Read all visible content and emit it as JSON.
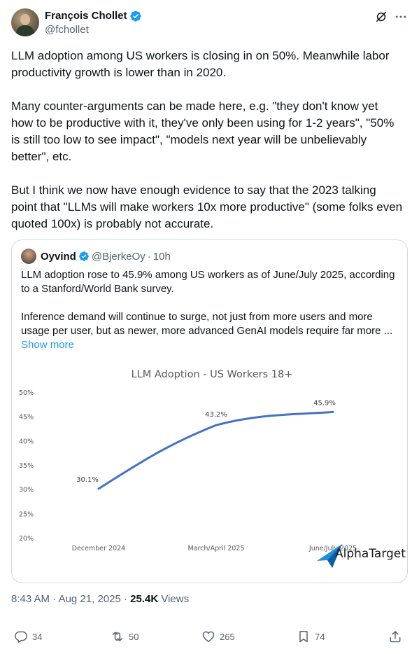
{
  "author": {
    "display_name": "François Chollet",
    "handle": "@fchollet"
  },
  "tweet": {
    "text": "LLM adoption among US workers is closing in on 50%. Meanwhile labor productivity growth is lower than in 2020.\n\nMany counter-arguments can be made here, e.g. \"they don't know yet how to be productive with it, they've only been using for 1-2 years\", \"50% is still too low to see impact\", \"models next year will be unbelievably better\", etc.\n\nBut I think we now have enough evidence to say that the 2023 talking point that \"LLMs will make workers 10x more productive\" (some folks even quoted 100x) is probably not accurate."
  },
  "quoted": {
    "display_name": "Oyvind",
    "handle": "@BjerkeOy",
    "separator": "·",
    "time": "10h",
    "text": "LLM adoption rose to 45.9% among US workers as of June/July 2025, according to a Stanford/World Bank survey.\n\nInference demand will continue to surge, not just from more users and more usage per user, but as newer, more advanced GenAI models require far more ...",
    "show_more": "Show more"
  },
  "chart_data": {
    "type": "line",
    "title": "LLM Adoption - US Workers 18+",
    "categories": [
      "December 2024",
      "March/April 2025",
      "June/July 2025"
    ],
    "values": [
      30.1,
      43.2,
      45.9
    ],
    "data_labels": [
      "30.1%",
      "43.2%",
      "45.9%"
    ],
    "y_ticks": [
      "20%",
      "25%",
      "30%",
      "35%",
      "40%",
      "45%",
      "50%"
    ],
    "y_tick_values": [
      20,
      25,
      30,
      35,
      40,
      45,
      50
    ],
    "ylim": [
      20,
      50
    ],
    "grid": false,
    "line_color": "#4472c4",
    "watermark": "AlphaTarget"
  },
  "meta": {
    "time": "8:43 AM",
    "separator": "·",
    "date": "Aug 21, 2025",
    "separator2": "·",
    "views_count": "25.4K",
    "views_label": "Views"
  },
  "actions": {
    "replies": "34",
    "reposts": "50",
    "likes": "265",
    "bookmarks": "74"
  },
  "colors": {
    "verified": "#1d9bf0",
    "link": "#1d9bf0",
    "secondary": "#536471"
  }
}
